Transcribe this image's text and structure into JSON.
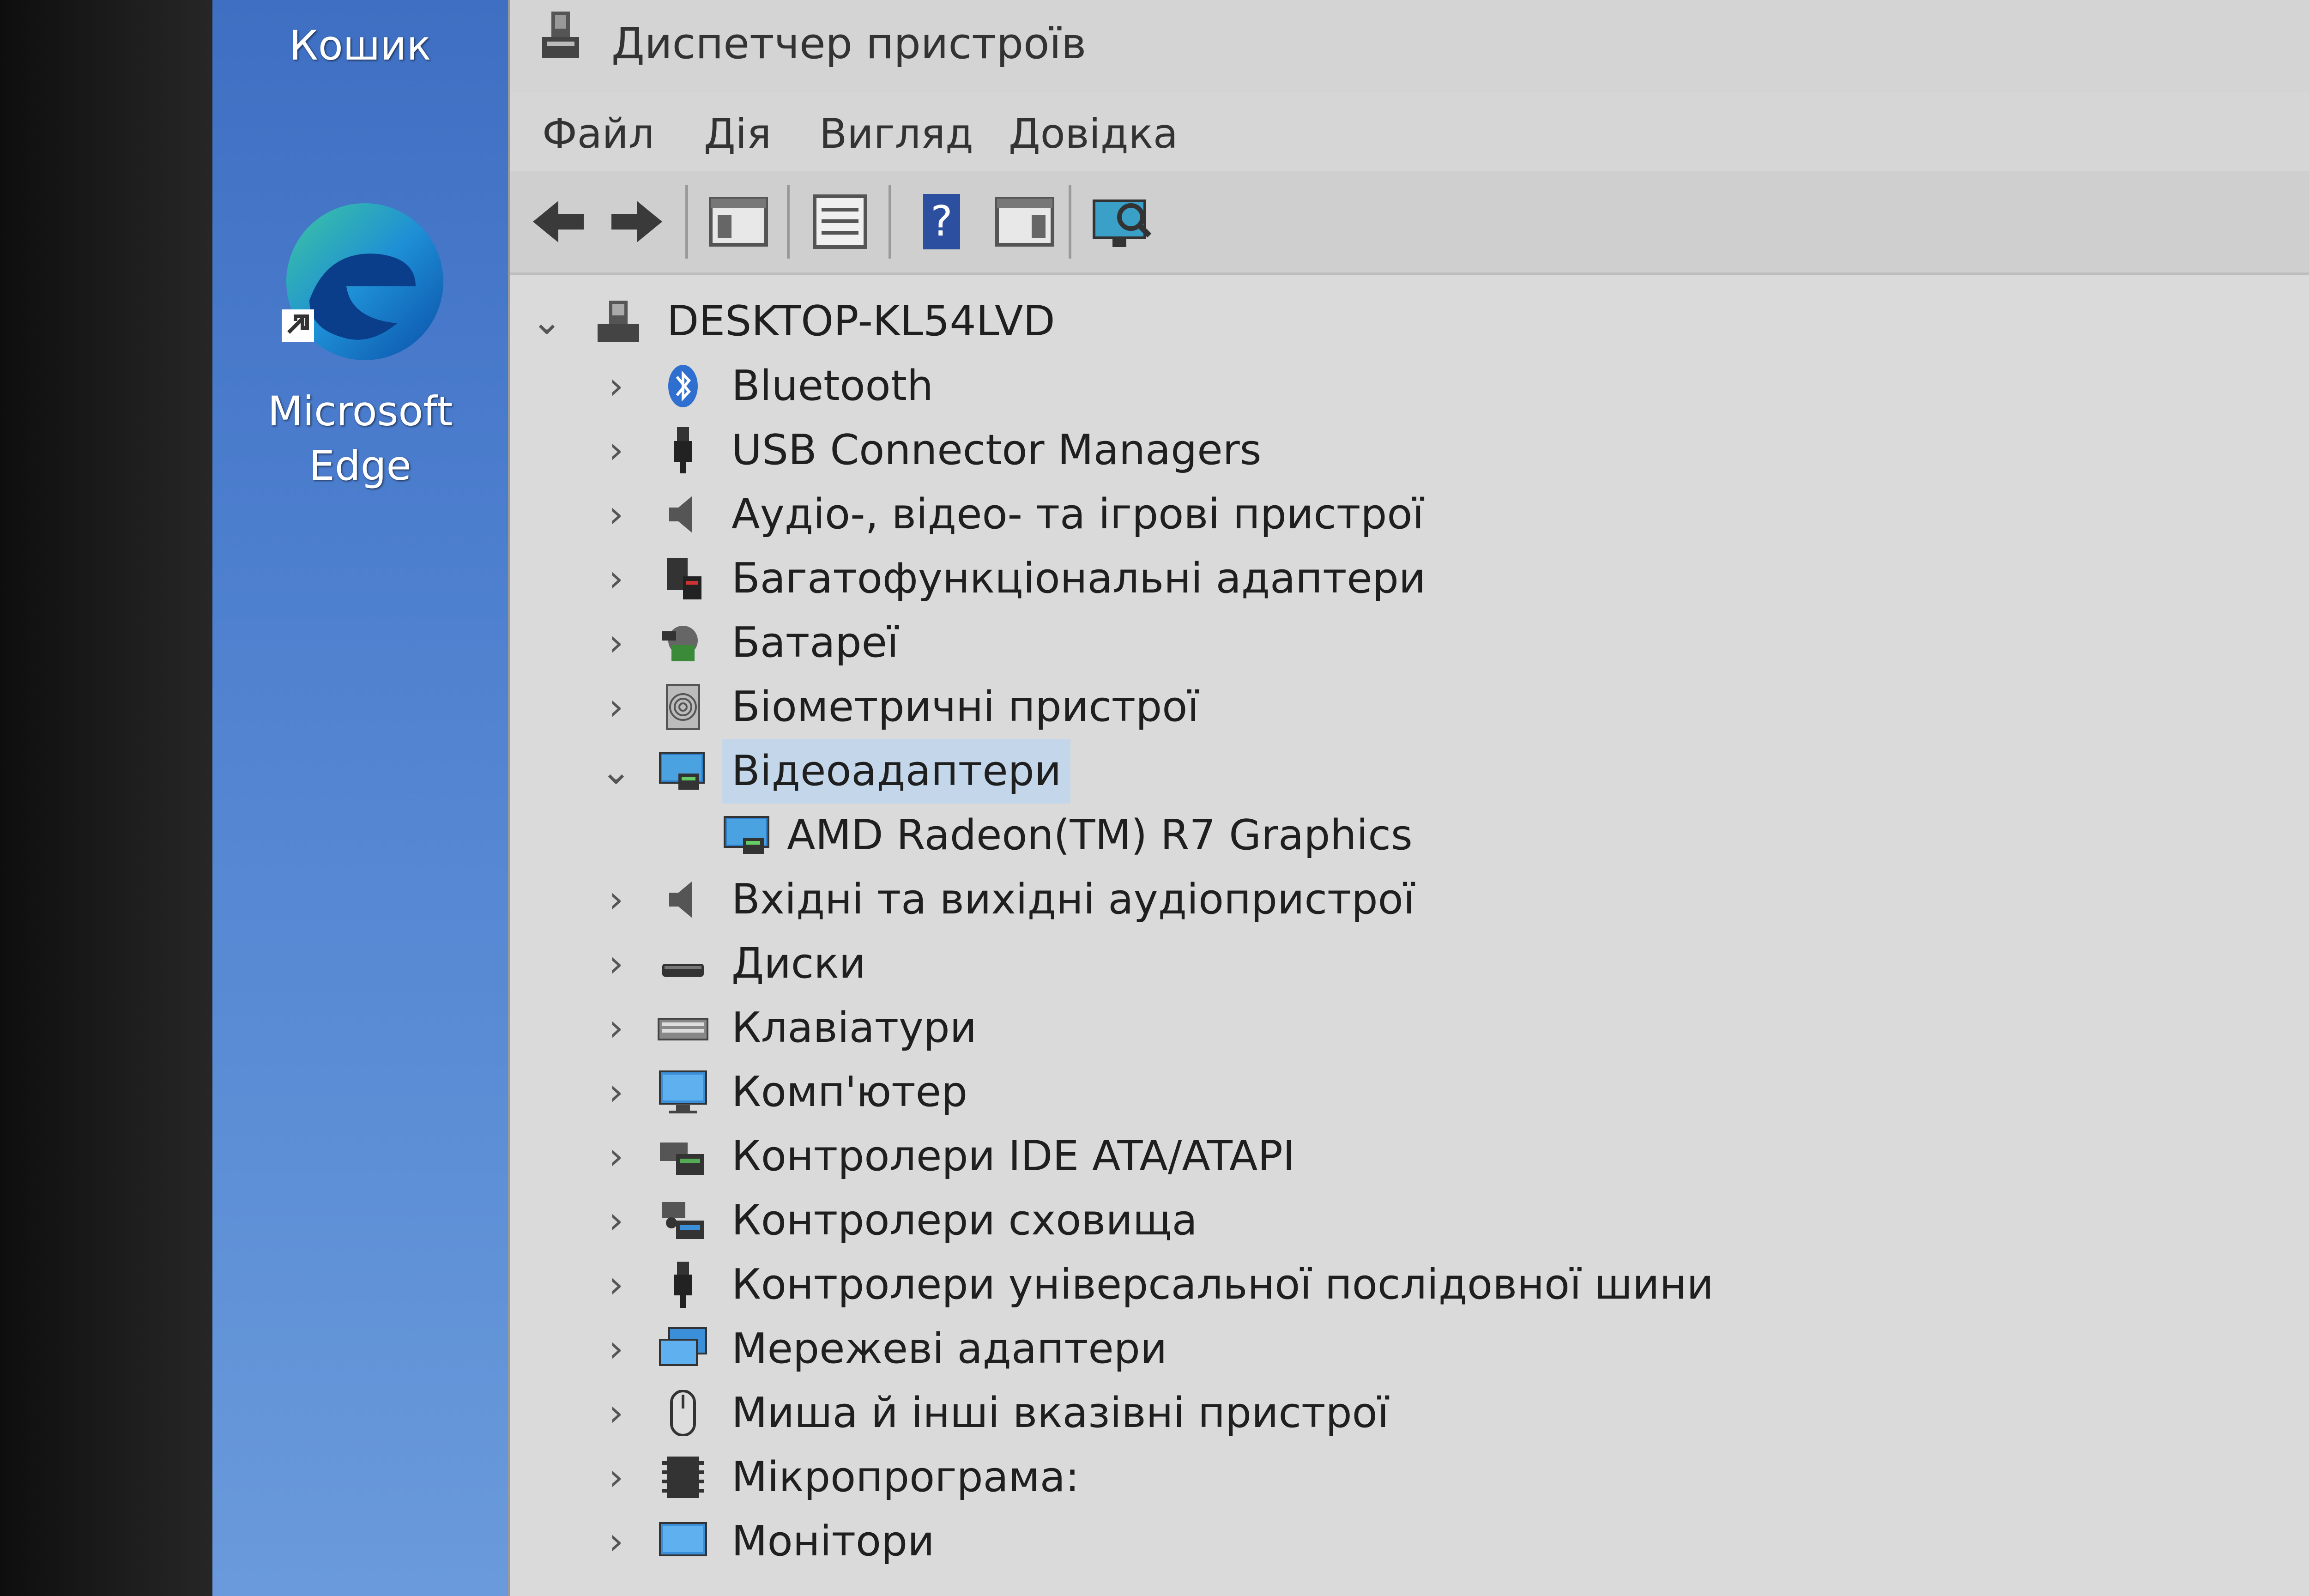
{
  "desktop": {
    "recycle_bin_label": "Кошик",
    "edge_label_line1": "Microsoft",
    "edge_label_line2": "Edge"
  },
  "window": {
    "title": "Диспетчер пристроїв",
    "menu": [
      "Файл",
      "Дія",
      "Вигляд",
      "Довідка"
    ]
  },
  "toolbar": {
    "buttons": [
      "back-icon",
      "forward-icon",
      "show-hide-console-tree-icon",
      "properties-icon",
      "help-icon",
      "action-pane-icon",
      "scan-hardware-icon"
    ]
  },
  "tree": {
    "root": "DESKTOP-KL54LVD",
    "items": [
      {
        "label": "Bluetooth",
        "icon": "bluetooth-icon",
        "expanded": false
      },
      {
        "label": "USB Connector Managers",
        "icon": "usb-connector-icon",
        "expanded": false
      },
      {
        "label": "Аудіо-, відео- та ігрові пристрої",
        "icon": "speaker-icon",
        "expanded": false
      },
      {
        "label": "Багатофункціональні адаптери",
        "icon": "multifunction-adapter-icon",
        "expanded": false
      },
      {
        "label": "Батареї",
        "icon": "battery-icon",
        "expanded": false
      },
      {
        "label": "Біометричні пристрої",
        "icon": "fingerprint-icon",
        "expanded": false
      },
      {
        "label": "Відеоадаптери",
        "icon": "display-adapter-icon",
        "expanded": true
      },
      {
        "label": "AMD Radeon(TM) R7 Graphics",
        "icon": "display-adapter-icon",
        "child": true
      },
      {
        "label": "Вхідні та вихідні аудіопристрої",
        "icon": "speaker-icon",
        "expanded": false
      },
      {
        "label": "Диски",
        "icon": "disk-drive-icon",
        "expanded": false
      },
      {
        "label": "Клавіатури",
        "icon": "keyboard-icon",
        "expanded": false
      },
      {
        "label": "Комп'ютер",
        "icon": "computer-icon",
        "expanded": false
      },
      {
        "label": "Контролери IDE ATA/ATAPI",
        "icon": "ide-controller-icon",
        "expanded": false
      },
      {
        "label": "Контролери сховища",
        "icon": "storage-controller-icon",
        "expanded": false
      },
      {
        "label": "Контролери універсальної послідовної шини",
        "icon": "usb-controller-icon",
        "expanded": false
      },
      {
        "label": "Мережеві адаптери",
        "icon": "network-adapter-icon",
        "expanded": false
      },
      {
        "label": "Миша й інші вказівні пристрої",
        "icon": "mouse-icon",
        "expanded": false
      },
      {
        "label": "Мікропрограма:",
        "icon": "firmware-icon",
        "expanded": false
      },
      {
        "label": "Монітори",
        "icon": "monitor-icon",
        "expanded": false
      }
    ]
  },
  "colors": {
    "desktop_blue": "#4d7fcf",
    "window_bg": "#dadada",
    "selection": "#c3d6ea",
    "folder_icon_blue": "#3a7bd5"
  }
}
